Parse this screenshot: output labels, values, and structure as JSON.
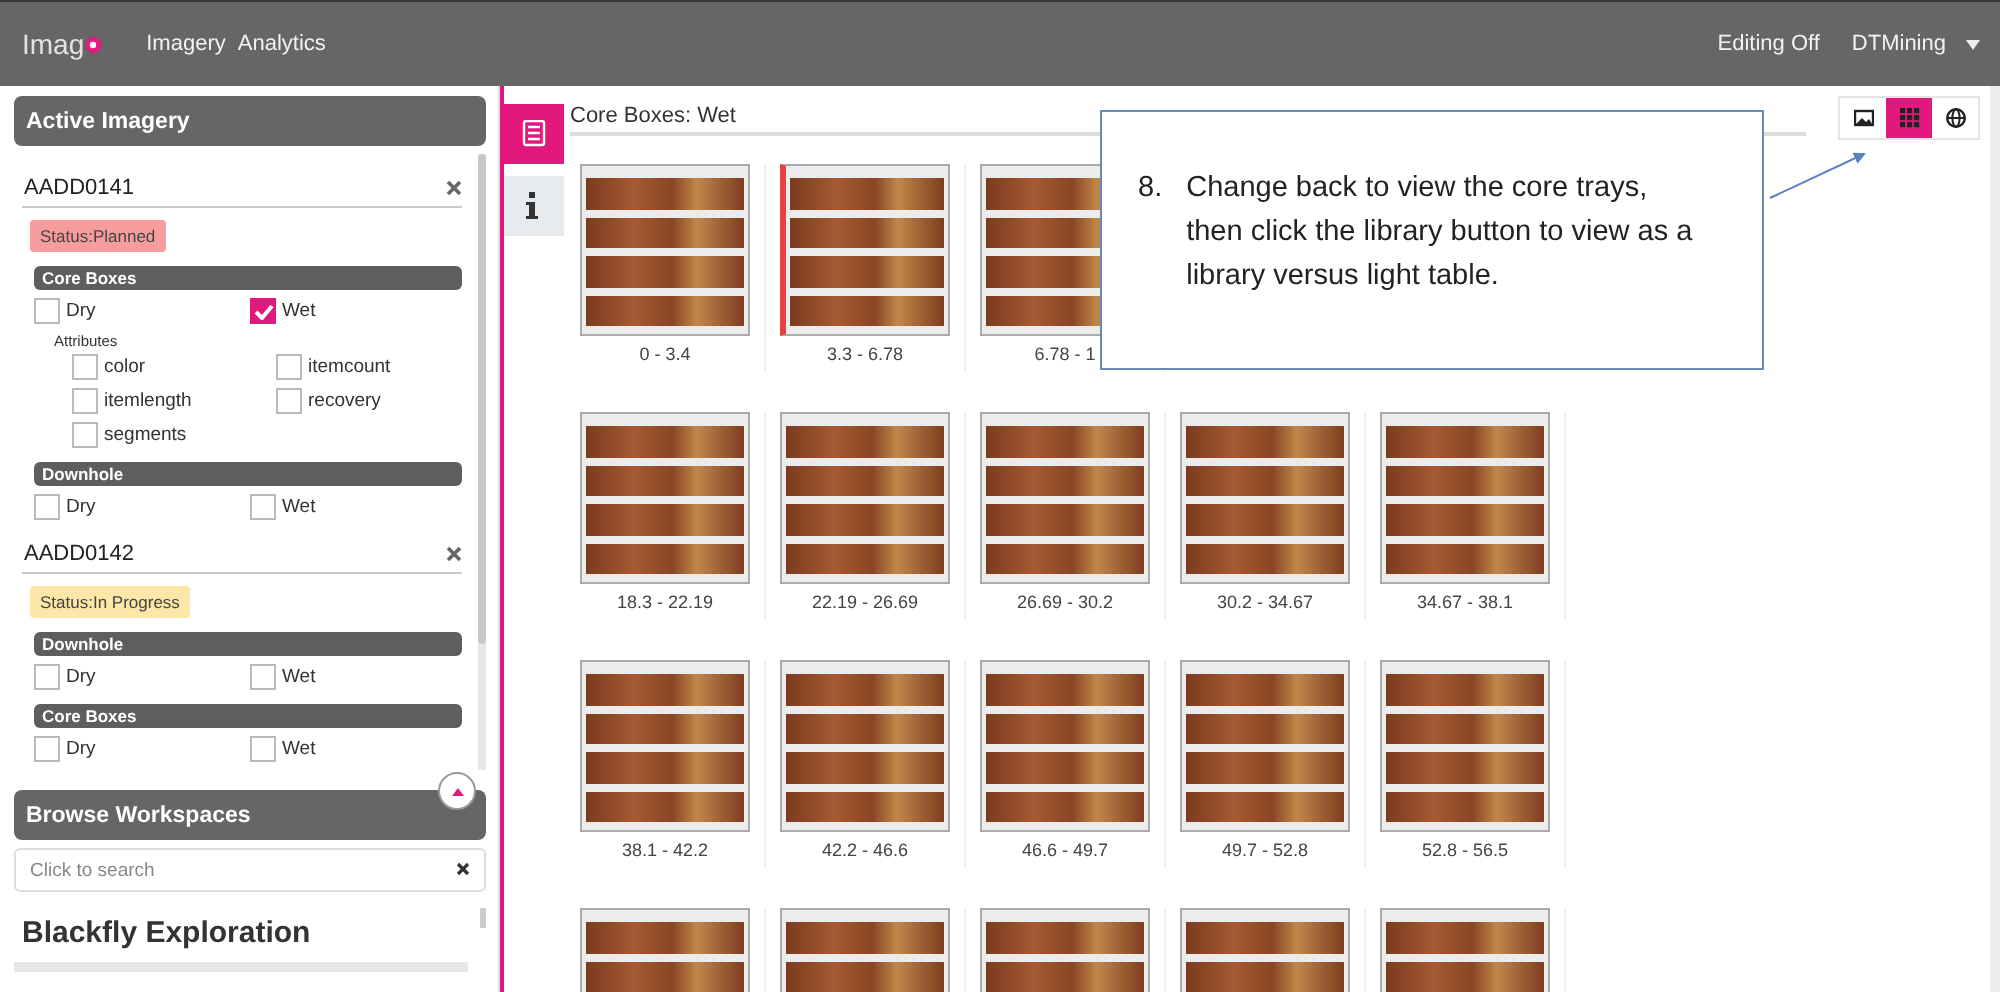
{
  "header": {
    "logo": "Imag",
    "nav": [
      {
        "label": "Imagery"
      },
      {
        "label": "Analytics"
      }
    ],
    "editing": "Editing Off",
    "user": "DTMining"
  },
  "active_imagery": {
    "title": "Active Imagery",
    "holes": [
      {
        "name": "AADD0141",
        "status": {
          "label": "Status:Planned",
          "color": "#f79c9c"
        },
        "sections": [
          {
            "title": "Core Boxes",
            "options": [
              {
                "label": "Dry",
                "checked": false
              },
              {
                "label": "Wet",
                "checked": true
              }
            ],
            "attributes_label": "Attributes",
            "attributes": [
              {
                "label": "color",
                "checked": false
              },
              {
                "label": "itemcount",
                "checked": false
              },
              {
                "label": "itemlength",
                "checked": false
              },
              {
                "label": "recovery",
                "checked": false
              },
              {
                "label": "segments",
                "checked": false
              }
            ]
          },
          {
            "title": "Downhole",
            "options": [
              {
                "label": "Dry",
                "checked": false
              },
              {
                "label": "Wet",
                "checked": false
              }
            ]
          }
        ]
      },
      {
        "name": "AADD0142",
        "status": {
          "label": "Status:In Progress",
          "color": "#fce7a8"
        },
        "sections": [
          {
            "title": "Downhole",
            "options": [
              {
                "label": "Dry",
                "checked": false
              },
              {
                "label": "Wet",
                "checked": false
              }
            ]
          },
          {
            "title": "Core Boxes",
            "options": [
              {
                "label": "Dry",
                "checked": false
              },
              {
                "label": "Wet",
                "checked": false
              }
            ]
          }
        ]
      }
    ]
  },
  "browse_workspaces": {
    "title": "Browse Workspaces",
    "search": {
      "placeholder": "Click to search"
    },
    "workspaces": [
      {
        "name": "Blackfly Exploration"
      }
    ]
  },
  "side_tabs": [
    {
      "kind": "list",
      "selected": true
    },
    {
      "kind": "info",
      "selected": false
    }
  ],
  "gallery": {
    "title": "Core Boxes: Wet",
    "view_buttons": [
      {
        "kind": "image",
        "selected": false
      },
      {
        "kind": "grid",
        "selected": true
      },
      {
        "kind": "globe",
        "selected": false
      }
    ],
    "rows": [
      [
        {
          "label": "0 - 3.4",
          "selected": false
        },
        {
          "label": "3.3 - 6.78",
          "selected": true
        },
        {
          "label": "6.78 - 1",
          "selected": false
        }
      ],
      [
        {
          "label": "18.3 - 22.19",
          "selected": false
        },
        {
          "label": "22.19 - 26.69",
          "selected": false
        },
        {
          "label": "26.69 - 30.2",
          "selected": false
        },
        {
          "label": "30.2 - 34.67",
          "selected": false
        },
        {
          "label": "34.67 - 38.1",
          "selected": false
        }
      ],
      [
        {
          "label": "38.1 - 42.2",
          "selected": false
        },
        {
          "label": "42.2 - 46.6",
          "selected": false
        },
        {
          "label": "46.6 - 49.7",
          "selected": false
        },
        {
          "label": "49.7 - 52.8",
          "selected": false
        },
        {
          "label": "52.8 - 56.5",
          "selected": false
        }
      ],
      [
        {
          "selected": false
        },
        {
          "selected": false
        },
        {
          "selected": false
        },
        {
          "selected": false
        },
        {
          "selected": false
        }
      ]
    ]
  },
  "callout": {
    "number": "8.",
    "text": "Change back to view the core trays, then click the library button to view as a library versus light table."
  }
}
